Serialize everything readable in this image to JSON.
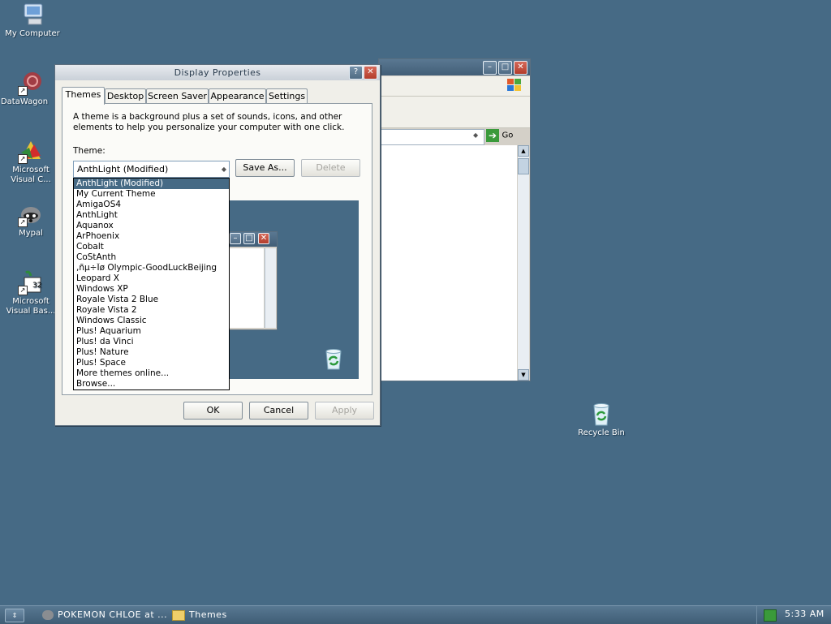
{
  "desktop": {
    "icons": [
      {
        "label": "My Computer"
      },
      {
        "label": "DataWagon"
      },
      {
        "label": "Microsoft Visual C..."
      },
      {
        "label": "Mypal"
      },
      {
        "label": "Microsoft Visual Bas..."
      },
      {
        "label": "Recycle Bin"
      }
    ]
  },
  "background_window": {
    "go_label": "Go"
  },
  "dialog": {
    "title": "Display Properties",
    "tabs": [
      {
        "label": "Themes"
      },
      {
        "label": "Desktop"
      },
      {
        "label": "Screen Saver"
      },
      {
        "label": "Appearance"
      },
      {
        "label": "Settings"
      }
    ],
    "description": "A theme is a background plus a set of sounds, icons, and other elements to help you personalize your computer with one click.",
    "theme_label": "Theme:",
    "theme_selected": "AnthLight (Modified)",
    "save_as_label": "Save As...",
    "delete_label": "Delete",
    "theme_options": [
      "AnthLight (Modified)",
      "My Current Theme",
      "AmigaOS4",
      "AnthLight",
      "Aquanox",
      "ArPhoenix",
      "Cobalt",
      "CoStAnth",
      ",ñµ÷Îø Olympic-GoodLuckBeijing",
      "Leopard X",
      "Windows XP",
      "Royale Vista 2 Blue",
      "Royale Vista 2",
      "Windows Classic",
      "Plus! Aquarium",
      "Plus! da Vinci",
      "Plus! Nature",
      "Plus! Space",
      "More themes online...",
      "Browse..."
    ],
    "ok_label": "OK",
    "cancel_label": "Cancel",
    "apply_label": "Apply"
  },
  "taskbar": {
    "start_label": "",
    "items": [
      {
        "label": "POKEMON CHLOE at ..."
      },
      {
        "label": "Themes"
      }
    ],
    "clock": "5:33 AM"
  },
  "colors": {
    "desktop": "#466a85",
    "selection": "#466a85",
    "close_button": "#c0483a"
  }
}
